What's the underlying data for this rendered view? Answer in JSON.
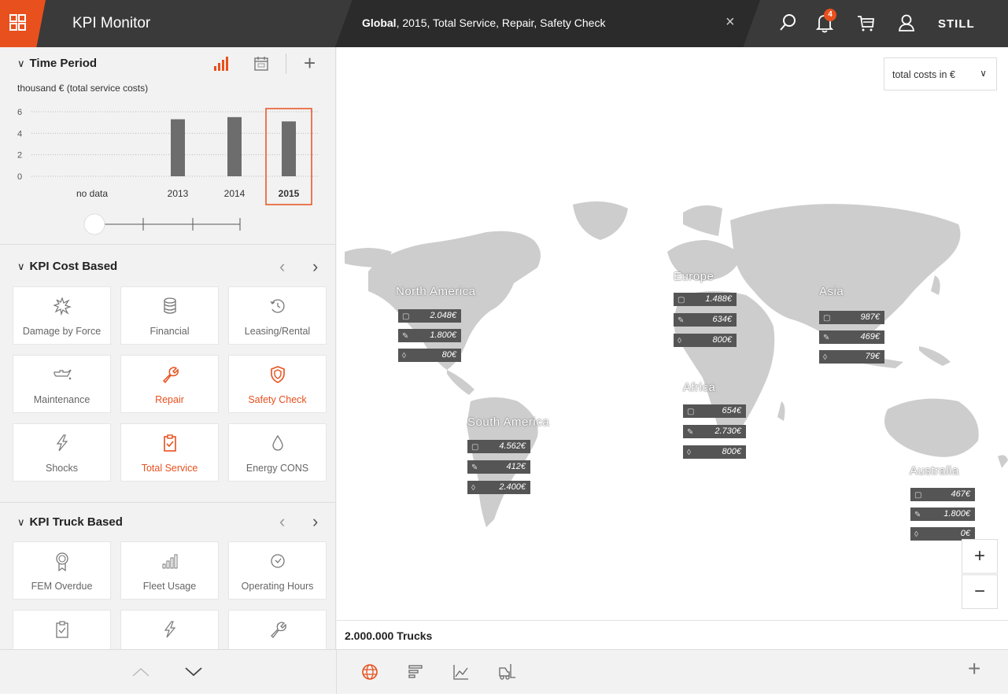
{
  "header": {
    "app_title": "KPI Monitor",
    "filter_bold": "Global",
    "filter_rest": ", 2015, Total Service, Repair, Safety Check",
    "close_label": "×",
    "notification_count": "4",
    "brand": "STILL",
    "accent_color": "#e8501e"
  },
  "time_period": {
    "title": "Time Period",
    "unit_label": "thousand € (total service costs)",
    "add_label": "+"
  },
  "chart_data": {
    "type": "bar",
    "categories": [
      "no data",
      "2013",
      "2014",
      "2015"
    ],
    "values": [
      null,
      5.3,
      5.5,
      5.1
    ],
    "ylim": [
      0,
      6
    ],
    "yticks": [
      "0",
      "2",
      "4",
      "6"
    ],
    "selected": "2015",
    "grid": true
  },
  "kpi_cost": {
    "title": "KPI Cost Based",
    "tiles": [
      {
        "label": "Damage by Force",
        "icon": "star-burst-icon",
        "active": false
      },
      {
        "label": "Financial",
        "icon": "database-icon",
        "active": false
      },
      {
        "label": "Leasing/Rental",
        "icon": "clock-rewind-icon",
        "active": false
      },
      {
        "label": "Maintenance",
        "icon": "oil-can-icon",
        "active": false
      },
      {
        "label": "Repair",
        "icon": "wrench-icon",
        "active": true
      },
      {
        "label": "Safety Check",
        "icon": "shield-icon",
        "active": true
      },
      {
        "label": "Shocks",
        "icon": "lightning-icon",
        "active": false
      },
      {
        "label": "Total Service",
        "icon": "clipboard-check-icon",
        "active": true
      },
      {
        "label": "Energy CONS",
        "icon": "drop-icon",
        "active": false
      }
    ]
  },
  "kpi_truck": {
    "title": "KPI Truck Based",
    "tiles": [
      {
        "label": "FEM Overdue",
        "icon": "award-icon"
      },
      {
        "label": "Fleet Usage",
        "icon": "bar-chart-icon"
      },
      {
        "label": "Operating Hours",
        "icon": "clock-icon"
      },
      {
        "label": "",
        "icon": "clipboard-check-icon"
      },
      {
        "label": "",
        "icon": "lightning-icon"
      },
      {
        "label": "",
        "icon": "wrench-icon"
      }
    ]
  },
  "map": {
    "dropdown_label": "total costs in €",
    "truck_count": "2.000.000 Trucks",
    "zoom_in": "+",
    "zoom_out": "−",
    "regions": [
      {
        "name": "North America",
        "values": [
          "2.048€",
          "1.800€",
          "80€"
        ]
      },
      {
        "name": "Europe",
        "values": [
          "1.488€",
          "634€",
          "800€"
        ]
      },
      {
        "name": "Asia",
        "values": [
          "987€",
          "469€",
          "79€"
        ]
      },
      {
        "name": "Africa",
        "values": [
          "654€",
          "2.730€",
          "800€"
        ]
      },
      {
        "name": "South America",
        "values": [
          "4.562€",
          "412€",
          "2.400€"
        ]
      },
      {
        "name": "Australia",
        "values": [
          "467€",
          "1.800€",
          "0€"
        ]
      }
    ]
  },
  "bottom": {
    "add_label": "+"
  }
}
